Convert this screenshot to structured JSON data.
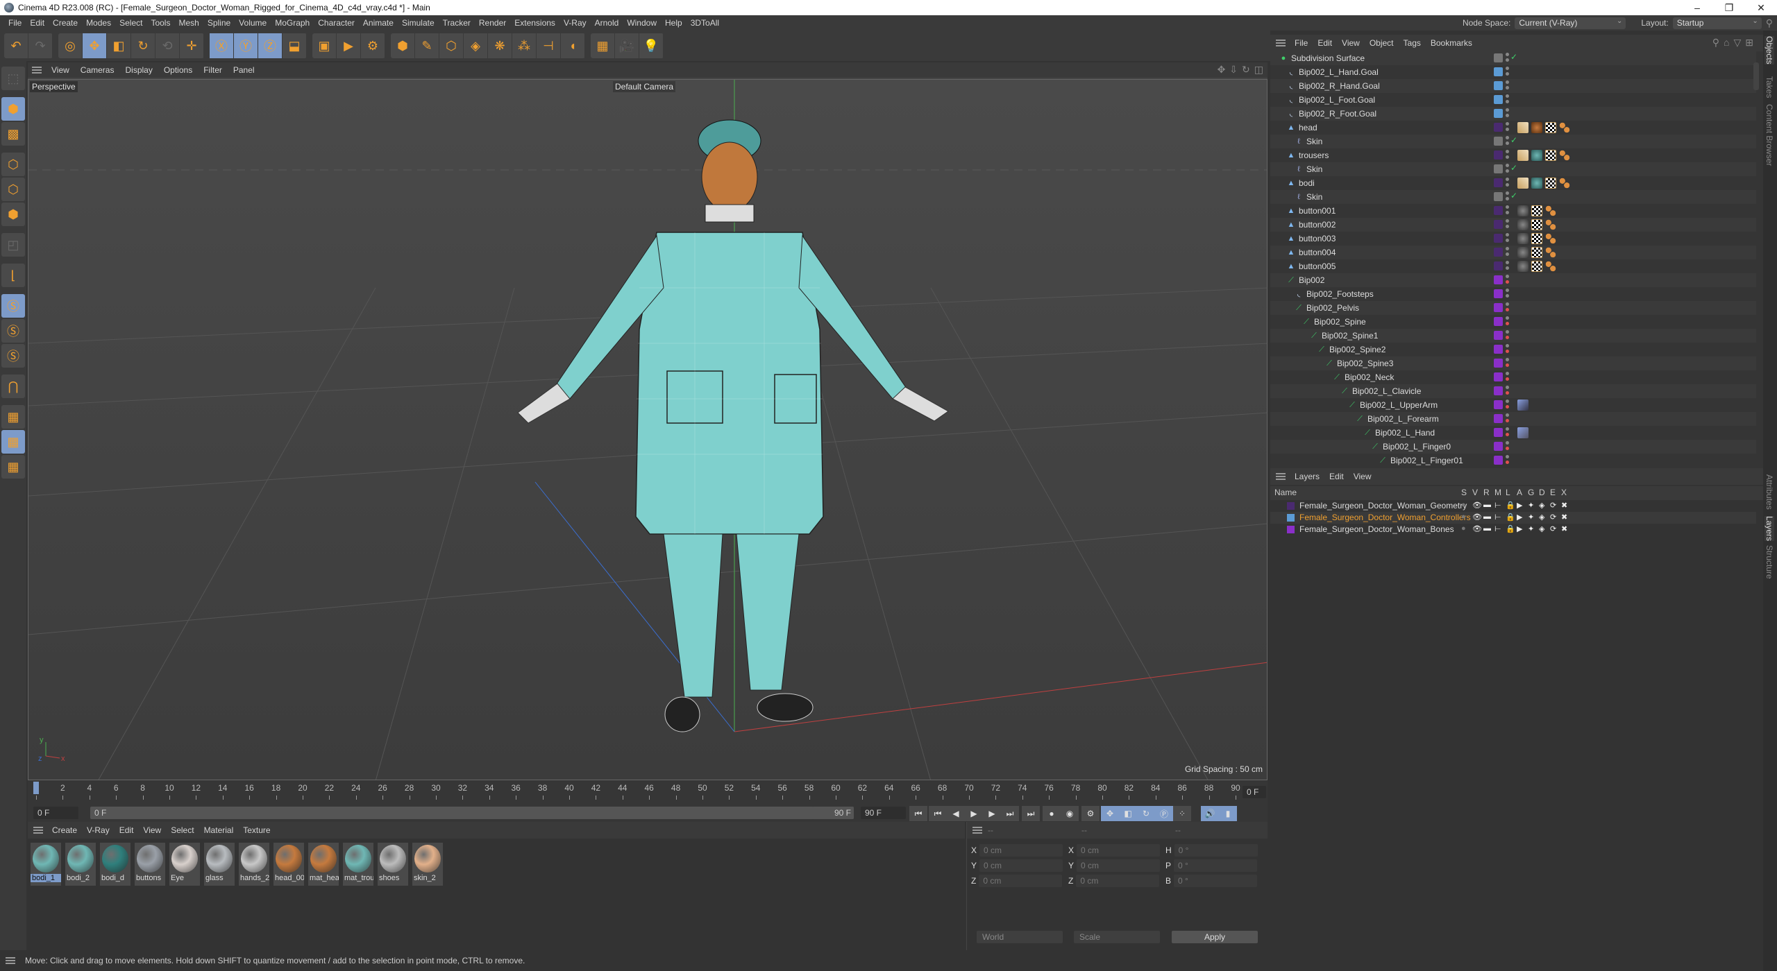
{
  "titlebar": {
    "title": "Cinema 4D R23.008 (RC) - [Female_Surgeon_Doctor_Woman_Rigged_for_Cinema_4D_c4d_vray.c4d *] - Main",
    "minimize": "–",
    "maximize": "❐",
    "close": "✕"
  },
  "menubar": {
    "items": [
      "File",
      "Edit",
      "Create",
      "Modes",
      "Select",
      "Tools",
      "Mesh",
      "Spline",
      "Volume",
      "MoGraph",
      "Character",
      "Animate",
      "Simulate",
      "Tracker",
      "Render",
      "Extensions",
      "V-Ray",
      "Arnold",
      "Window",
      "Help",
      "3DToAll"
    ],
    "node_space_label": "Node Space:",
    "node_space_value": "Current (V-Ray)",
    "layout_label": "Layout:",
    "layout_value": "Startup"
  },
  "toolbar": {
    "groups": [
      [
        {
          "icon": "undo-icon",
          "glyph": "↶"
        },
        {
          "icon": "redo-icon",
          "glyph": "↷",
          "dim": true
        }
      ],
      [
        {
          "icon": "select-icon",
          "glyph": "◎"
        },
        {
          "icon": "move-icon",
          "glyph": "✥",
          "sel": true
        },
        {
          "icon": "scale-icon",
          "glyph": "◧"
        },
        {
          "icon": "rotate-icon",
          "glyph": "↻"
        },
        {
          "icon": "psr-icon",
          "glyph": "⟲",
          "dim": true
        },
        {
          "icon": "move-alt-icon",
          "glyph": "✛"
        }
      ],
      [
        {
          "icon": "x-axis-icon",
          "glyph": "Ⓧ",
          "sel": true
        },
        {
          "icon": "y-axis-icon",
          "glyph": "Ⓨ",
          "sel": true
        },
        {
          "icon": "z-axis-icon",
          "glyph": "Ⓩ",
          "sel": true
        },
        {
          "icon": "coordinate-system-icon",
          "glyph": "⬓"
        }
      ],
      [
        {
          "icon": "render-region-icon",
          "glyph": "▣"
        },
        {
          "icon": "render-view-icon",
          "glyph": "▶"
        },
        {
          "icon": "render-settings-icon",
          "glyph": "⚙"
        }
      ],
      [
        {
          "icon": "cube-icon",
          "glyph": "⬢"
        },
        {
          "icon": "pen-icon",
          "glyph": "✎"
        },
        {
          "icon": "subdivision-icon",
          "glyph": "⬡"
        },
        {
          "icon": "extrude-icon",
          "glyph": "◈"
        },
        {
          "icon": "cloner-icon",
          "glyph": "❋"
        },
        {
          "icon": "mograph-icon",
          "glyph": "⁂"
        },
        {
          "icon": "deformer-icon",
          "glyph": "⊣"
        },
        {
          "icon": "bend-icon",
          "glyph": "◖"
        }
      ],
      [
        {
          "icon": "floor-icon",
          "glyph": "▦"
        },
        {
          "icon": "camera-icon",
          "glyph": "🎥"
        },
        {
          "icon": "light-icon",
          "glyph": "💡"
        }
      ]
    ]
  },
  "left_tools": [
    {
      "icon": "make-editable-icon",
      "glyph": "⬚",
      "dim": true
    },
    {
      "icon": "model-mode-icon",
      "glyph": "⬢",
      "sel": true,
      "gap": true
    },
    {
      "icon": "texture-mode-icon",
      "glyph": "▩"
    },
    {
      "icon": "points-mode-icon",
      "glyph": "⬡",
      "gap": true
    },
    {
      "icon": "edges-mode-icon",
      "glyph": "⬡"
    },
    {
      "icon": "polygons-mode-icon",
      "glyph": "⬢"
    },
    {
      "icon": "uv-mode-icon",
      "glyph": "◰",
      "dim": true,
      "gap": true
    },
    {
      "icon": "axis-mode-icon",
      "glyph": "⌊",
      "gap": true
    },
    {
      "icon": "solo-icon",
      "glyph": "Ⓢ",
      "sel": true,
      "gap": true
    },
    {
      "icon": "solo-hierarchy-icon",
      "glyph": "Ⓢ"
    },
    {
      "icon": "solo-off-icon",
      "glyph": "Ⓢ"
    },
    {
      "icon": "snap-icon",
      "glyph": "⋂",
      "gap": true
    },
    {
      "icon": "workplane-icon",
      "glyph": "▦",
      "gap": true
    },
    {
      "icon": "locked-workplane-icon",
      "glyph": "▦",
      "sel": true
    },
    {
      "icon": "workplane-align-icon",
      "glyph": "▦"
    }
  ],
  "viewport": {
    "menu": [
      "View",
      "Cameras",
      "Display",
      "Options",
      "Filter",
      "Panel"
    ],
    "view_name": "Perspective",
    "camera": "Default Camera",
    "grid_spacing": "Grid Spacing : 50 cm"
  },
  "timeline": {
    "ticks": [
      "0",
      "2",
      "4",
      "6",
      "8",
      "10",
      "12",
      "14",
      "16",
      "18",
      "20",
      "22",
      "24",
      "26",
      "28",
      "30",
      "32",
      "34",
      "36",
      "38",
      "40",
      "42",
      "44",
      "46",
      "48",
      "50",
      "52",
      "54",
      "56",
      "58",
      "60",
      "62",
      "64",
      "66",
      "68",
      "70",
      "72",
      "74",
      "76",
      "78",
      "80",
      "82",
      "84",
      "86",
      "88",
      "90"
    ],
    "current_frame": "0 F"
  },
  "transport": {
    "start_frame": "0 F",
    "range_start": "0 F",
    "range_end": "90 F",
    "end_frame": "90 F"
  },
  "material_manager": {
    "menu": [
      "Create",
      "V-Ray",
      "Edit",
      "View",
      "Select",
      "Material",
      "Texture"
    ],
    "materials": [
      {
        "name": "bodi_1",
        "color": "#6fb7b4",
        "selected": true
      },
      {
        "name": "bodi_2",
        "color": "#6fb7b4"
      },
      {
        "name": "bodi_d",
        "color": "#2f7f7c"
      },
      {
        "name": "buttons",
        "color": "#9aa0a8"
      },
      {
        "name": "Eye",
        "color": "#d8d0cc"
      },
      {
        "name": "glass",
        "color": "#b8bcc0"
      },
      {
        "name": "hands_2",
        "color": "#c8c8c8"
      },
      {
        "name": "head_00",
        "color": "#c57a3e"
      },
      {
        "name": "mat_hea",
        "color": "#c57a3e"
      },
      {
        "name": "mat_trou",
        "color": "#6fb7b4"
      },
      {
        "name": "shoes",
        "color": "#bcbcbc"
      },
      {
        "name": "skin_2",
        "color": "#e2b08a"
      }
    ]
  },
  "coordinates": {
    "headers": [
      "--",
      "--",
      "--"
    ],
    "rows": [
      {
        "a": "X",
        "av": "0 cm",
        "b": "X",
        "bv": "0 cm",
        "c": "H",
        "cv": "0 °"
      },
      {
        "a": "Y",
        "av": "0 cm",
        "b": "Y",
        "bv": "0 cm",
        "c": "P",
        "cv": "0 °"
      },
      {
        "a": "Z",
        "av": "0 cm",
        "b": "Z",
        "bv": "0 cm",
        "c": "B",
        "cv": "0 °"
      }
    ],
    "space": "World",
    "mode": "Scale",
    "apply": "Apply"
  },
  "status": "Move: Click and drag to move elements. Hold down SHIFT to quantize movement / add to the selection in point mode, CTRL to remove.",
  "object_manager": {
    "menu": [
      "File",
      "Edit",
      "View",
      "Object",
      "Tags",
      "Bookmarks"
    ],
    "objects": [
      {
        "name": "Subdivision Surface",
        "depth": 0,
        "type": "subdiv",
        "layer": "gray",
        "check": true,
        "tags": []
      },
      {
        "name": "Bip002_L_Hand.Goal",
        "depth": 1,
        "type": "null",
        "layer": "#5b9bd5",
        "tags": []
      },
      {
        "name": "Bip002_R_Hand.Goal",
        "depth": 1,
        "type": "null",
        "layer": "#5b9bd5",
        "tags": []
      },
      {
        "name": "Bip002_L_Foot.Goal",
        "depth": 1,
        "type": "null",
        "layer": "#5b9bd5",
        "tags": []
      },
      {
        "name": "Bip002_R_Foot.Goal",
        "depth": 1,
        "type": "null",
        "layer": "#5b9bd5",
        "tags": []
      },
      {
        "name": "head",
        "depth": 1,
        "type": "poly",
        "layer": "#4a2a70",
        "tags": [
          "weight",
          "mat-brown",
          "uvw",
          "dots"
        ]
      },
      {
        "name": "Skin",
        "depth": 2,
        "type": "skin",
        "layer": "gray",
        "check": true,
        "tags": []
      },
      {
        "name": "trousers",
        "depth": 1,
        "type": "poly",
        "layer": "#4a2a70",
        "tags": [
          "weight",
          "mat-teal",
          "uvw",
          "dots"
        ]
      },
      {
        "name": "Skin",
        "depth": 2,
        "type": "skin",
        "layer": "gray",
        "check": true,
        "tags": []
      },
      {
        "name": "bodi",
        "depth": 1,
        "type": "poly",
        "layer": "#4a2a70",
        "tags": [
          "weight",
          "mat-teal",
          "uvw",
          "dots"
        ]
      },
      {
        "name": "Skin",
        "depth": 2,
        "type": "skin",
        "layer": "gray",
        "check": true,
        "tags": []
      },
      {
        "name": "button001",
        "depth": 1,
        "type": "poly",
        "layer": "#4a2a70",
        "tags": [
          "mat-gray",
          "uvw",
          "dots"
        ]
      },
      {
        "name": "button002",
        "depth": 1,
        "type": "poly",
        "layer": "#4a2a70",
        "tags": [
          "mat-gray",
          "uvw",
          "dots"
        ]
      },
      {
        "name": "button003",
        "depth": 1,
        "type": "poly",
        "layer": "#4a2a70",
        "tags": [
          "mat-gray",
          "uvw",
          "dots"
        ]
      },
      {
        "name": "button004",
        "depth": 1,
        "type": "poly",
        "layer": "#4a2a70",
        "tags": [
          "mat-gray",
          "uvw",
          "dots"
        ]
      },
      {
        "name": "button005",
        "depth": 1,
        "type": "poly",
        "layer": "#4a2a70",
        "tags": [
          "mat-gray",
          "uvw",
          "dots"
        ]
      },
      {
        "name": "Bip002",
        "depth": 1,
        "type": "bone",
        "layer": "#8a2fc9",
        "red": true,
        "tags": []
      },
      {
        "name": "Bip002_Footsteps",
        "depth": 2,
        "type": "null",
        "layer": "#8a2fc9",
        "tags": []
      },
      {
        "name": "Bip002_Pelvis",
        "depth": 2,
        "type": "bone",
        "layer": "#8a2fc9",
        "red": true,
        "tags": []
      },
      {
        "name": "Bip002_Spine",
        "depth": 3,
        "type": "bone",
        "layer": "#8a2fc9",
        "red": true,
        "tags": []
      },
      {
        "name": "Bip002_Spine1",
        "depth": 4,
        "type": "bone",
        "layer": "#8a2fc9",
        "red": true,
        "tags": []
      },
      {
        "name": "Bip002_Spine2",
        "depth": 5,
        "type": "bone",
        "layer": "#8a2fc9",
        "red": true,
        "tags": []
      },
      {
        "name": "Bip002_Spine3",
        "depth": 6,
        "type": "bone",
        "layer": "#8a2fc9",
        "red": true,
        "tags": []
      },
      {
        "name": "Bip002_Neck",
        "depth": 7,
        "type": "bone",
        "layer": "#8a2fc9",
        "red": true,
        "tags": []
      },
      {
        "name": "Bip002_L_Clavicle",
        "depth": 8,
        "type": "bone",
        "layer": "#8a2fc9",
        "red": true,
        "tags": []
      },
      {
        "name": "Bip002_L_UpperArm",
        "depth": 9,
        "type": "bone",
        "layer": "#8a2fc9",
        "red": true,
        "tags": [
          "ik"
        ]
      },
      {
        "name": "Bip002_L_Forearm",
        "depth": 10,
        "type": "bone",
        "layer": "#8a2fc9",
        "red": true,
        "tags": []
      },
      {
        "name": "Bip002_L_Hand",
        "depth": 11,
        "type": "bone",
        "layer": "#8a2fc9",
        "red": true,
        "tags": [
          "pin"
        ]
      },
      {
        "name": "Bip002_L_Finger0",
        "depth": 12,
        "type": "bone",
        "layer": "#8a2fc9",
        "red": true,
        "tags": []
      },
      {
        "name": "Bip002_L_Finger01",
        "depth": 13,
        "type": "bone",
        "layer": "#8a2fc9",
        "red": true,
        "tags": []
      }
    ]
  },
  "layer_manager": {
    "menu": [
      "Layers",
      "Edit",
      "View"
    ],
    "name_col": "Name",
    "cols": [
      "S",
      "V",
      "R",
      "M",
      "L",
      "A",
      "G",
      "D",
      "E",
      "X"
    ],
    "layers": [
      {
        "name": "Female_Surgeon_Doctor_Woman_Geometry",
        "color": "#4a2a70",
        "active": false
      },
      {
        "name": "Female_Surgeon_Doctor_Woman_Controllers",
        "color": "#5b9bd5",
        "active": true
      },
      {
        "name": "Female_Surgeon_Doctor_Woman_Bones",
        "color": "#8a2fc9",
        "active": false
      }
    ]
  },
  "side_tabs": {
    "top": [
      "Objects",
      "Takes",
      "Content Browser"
    ],
    "bottom": [
      "Attributes",
      "Layers",
      "Structure"
    ]
  }
}
